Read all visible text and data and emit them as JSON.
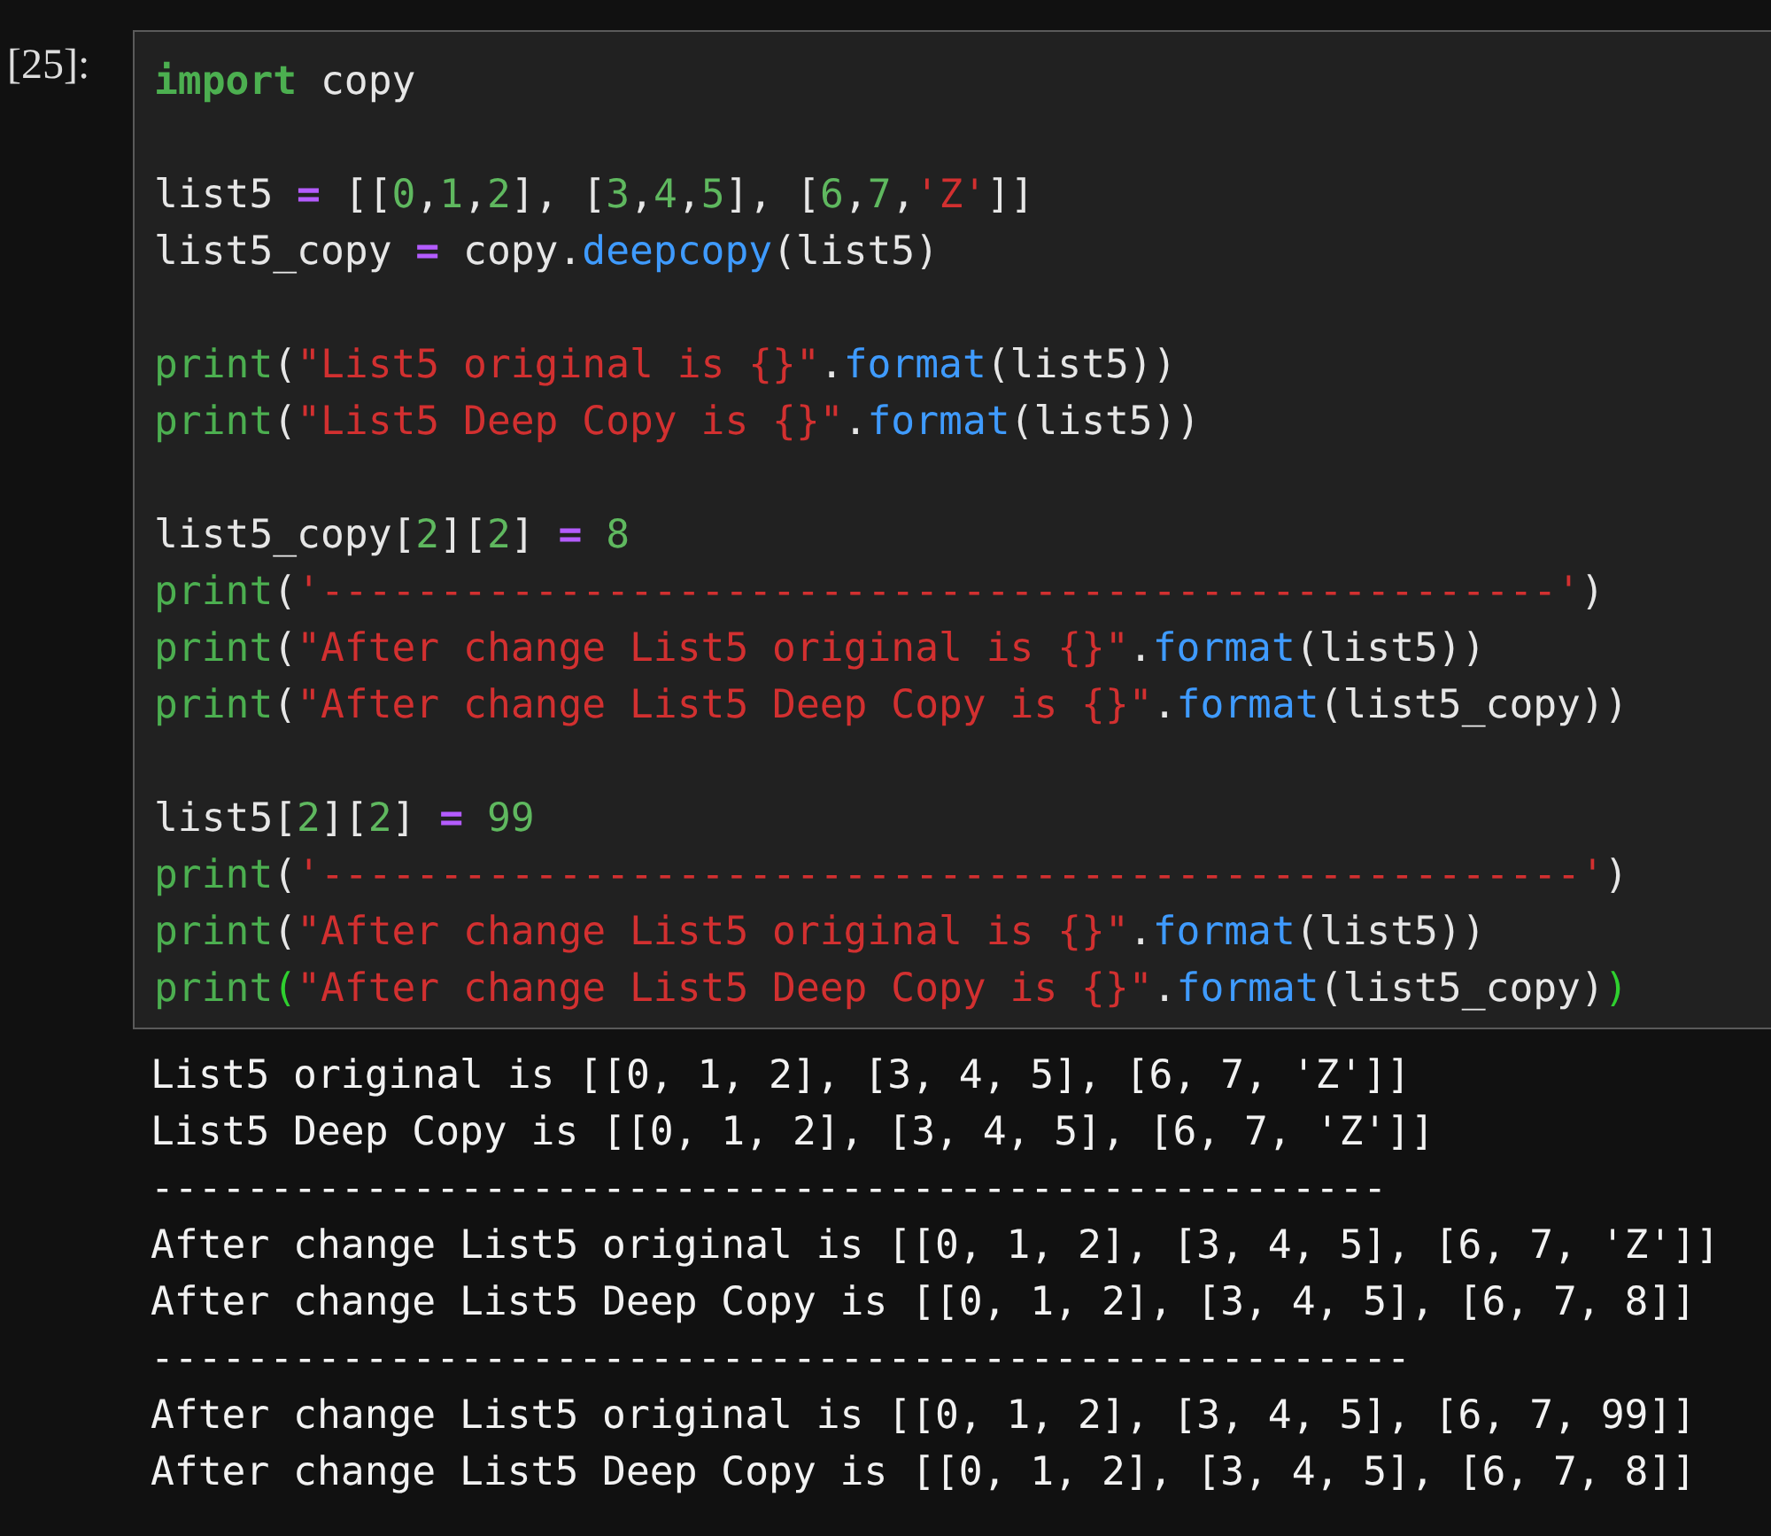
{
  "cell": {
    "prompt": "[25]:",
    "code_blocks": [
      [
        [
          {
            "kind": "keyword",
            "text": "import"
          },
          {
            "kind": "name",
            "text": " copy"
          }
        ]
      ],
      [
        [
          {
            "kind": "name",
            "text": "list5 "
          },
          {
            "kind": "operator",
            "text": "="
          },
          {
            "kind": "punct",
            "text": " [["
          },
          {
            "kind": "number",
            "text": "0"
          },
          {
            "kind": "punct",
            "text": ","
          },
          {
            "kind": "number",
            "text": "1"
          },
          {
            "kind": "punct",
            "text": ","
          },
          {
            "kind": "number",
            "text": "2"
          },
          {
            "kind": "punct",
            "text": "], ["
          },
          {
            "kind": "number",
            "text": "3"
          },
          {
            "kind": "punct",
            "text": ","
          },
          {
            "kind": "number",
            "text": "4"
          },
          {
            "kind": "punct",
            "text": ","
          },
          {
            "kind": "number",
            "text": "5"
          },
          {
            "kind": "punct",
            "text": "], ["
          },
          {
            "kind": "number",
            "text": "6"
          },
          {
            "kind": "punct",
            "text": ","
          },
          {
            "kind": "number",
            "text": "7"
          },
          {
            "kind": "punct",
            "text": ","
          },
          {
            "kind": "string",
            "text": "'Z'"
          },
          {
            "kind": "punct",
            "text": "]]"
          }
        ],
        [
          {
            "kind": "name",
            "text": "list5_copy "
          },
          {
            "kind": "operator",
            "text": "="
          },
          {
            "kind": "name",
            "text": " copy."
          },
          {
            "kind": "function",
            "text": "deepcopy"
          },
          {
            "kind": "punct",
            "text": "(list5)"
          }
        ]
      ],
      [
        [
          {
            "kind": "builtin",
            "text": "print"
          },
          {
            "kind": "punct",
            "text": "("
          },
          {
            "kind": "string",
            "text": "\"List5 original is {}\""
          },
          {
            "kind": "punct",
            "text": "."
          },
          {
            "kind": "function",
            "text": "format"
          },
          {
            "kind": "punct",
            "text": "(list5))"
          }
        ],
        [
          {
            "kind": "builtin",
            "text": "print"
          },
          {
            "kind": "punct",
            "text": "("
          },
          {
            "kind": "string",
            "text": "\"List5 Deep Copy is {}\""
          },
          {
            "kind": "punct",
            "text": "."
          },
          {
            "kind": "function",
            "text": "format"
          },
          {
            "kind": "punct",
            "text": "(list5))"
          }
        ]
      ],
      [
        [
          {
            "kind": "name",
            "text": "list5_copy["
          },
          {
            "kind": "number",
            "text": "2"
          },
          {
            "kind": "punct",
            "text": "]["
          },
          {
            "kind": "number",
            "text": "2"
          },
          {
            "kind": "punct",
            "text": "] "
          },
          {
            "kind": "operator",
            "text": "="
          },
          {
            "kind": "number",
            "text": " 8"
          }
        ],
        [
          {
            "kind": "builtin",
            "text": "print"
          },
          {
            "kind": "punct",
            "text": "("
          },
          {
            "kind": "string",
            "text": "'----------------------------------------------------'"
          },
          {
            "kind": "punct",
            "text": ")"
          }
        ],
        [
          {
            "kind": "builtin",
            "text": "print"
          },
          {
            "kind": "punct",
            "text": "("
          },
          {
            "kind": "string",
            "text": "\"After change List5 original is {}\""
          },
          {
            "kind": "punct",
            "text": "."
          },
          {
            "kind": "function",
            "text": "format"
          },
          {
            "kind": "punct",
            "text": "(list5))"
          }
        ],
        [
          {
            "kind": "builtin",
            "text": "print"
          },
          {
            "kind": "punct",
            "text": "("
          },
          {
            "kind": "string",
            "text": "\"After change List5 Deep Copy is {}\""
          },
          {
            "kind": "punct",
            "text": "."
          },
          {
            "kind": "function",
            "text": "format"
          },
          {
            "kind": "punct",
            "text": "(list5_copy))"
          }
        ]
      ],
      [
        [
          {
            "kind": "name",
            "text": "list5["
          },
          {
            "kind": "number",
            "text": "2"
          },
          {
            "kind": "punct",
            "text": "]["
          },
          {
            "kind": "number",
            "text": "2"
          },
          {
            "kind": "punct",
            "text": "] "
          },
          {
            "kind": "operator",
            "text": "="
          },
          {
            "kind": "number",
            "text": " 99"
          }
        ],
        [
          {
            "kind": "builtin",
            "text": "print"
          },
          {
            "kind": "punct",
            "text": "("
          },
          {
            "kind": "string",
            "text": "'-----------------------------------------------------'"
          },
          {
            "kind": "punct",
            "text": ")"
          }
        ],
        [
          {
            "kind": "builtin",
            "text": "print"
          },
          {
            "kind": "punct",
            "text": "("
          },
          {
            "kind": "string",
            "text": "\"After change List5 original is {}\""
          },
          {
            "kind": "punct",
            "text": "."
          },
          {
            "kind": "function",
            "text": "format"
          },
          {
            "kind": "punct",
            "text": "(list5))"
          }
        ],
        [
          {
            "kind": "builtin",
            "text": "print"
          },
          {
            "kind": "matched_bracket",
            "text": "("
          },
          {
            "kind": "string",
            "text": "\"After change List5 Deep Copy is {}\""
          },
          {
            "kind": "punct",
            "text": "."
          },
          {
            "kind": "function",
            "text": "format"
          },
          {
            "kind": "punct",
            "text": "(list5_copy)"
          },
          {
            "kind": "matched_bracket",
            "text": ")"
          }
        ]
      ]
    ],
    "output": [
      "List5 original is [[0, 1, 2], [3, 4, 5], [6, 7, 'Z']]",
      "List5 Deep Copy is [[0, 1, 2], [3, 4, 5], [6, 7, 'Z']]",
      "----------------------------------------------------",
      "After change List5 original is [[0, 1, 2], [3, 4, 5], [6, 7, 'Z']]",
      "After change List5 Deep Copy is [[0, 1, 2], [3, 4, 5], [6, 7, 8]]",
      "-----------------------------------------------------",
      "After change List5 original is [[0, 1, 2], [3, 4, 5], [6, 7, 99]]",
      "After change List5 Deep Copy is [[0, 1, 2], [3, 4, 5], [6, 7, 8]]"
    ]
  }
}
